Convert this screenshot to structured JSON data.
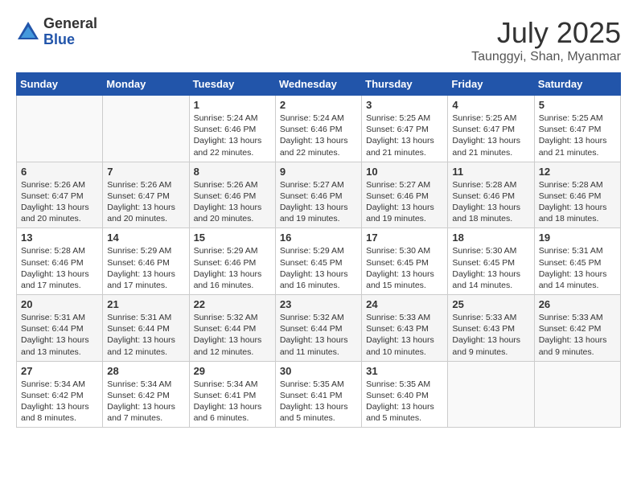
{
  "header": {
    "logo_general": "General",
    "logo_blue": "Blue",
    "month_year": "July 2025",
    "location": "Taunggyi, Shan, Myanmar"
  },
  "weekdays": [
    "Sunday",
    "Monday",
    "Tuesday",
    "Wednesday",
    "Thursday",
    "Friday",
    "Saturday"
  ],
  "weeks": [
    [
      {
        "day": "",
        "info": ""
      },
      {
        "day": "",
        "info": ""
      },
      {
        "day": "1",
        "info": "Sunrise: 5:24 AM\nSunset: 6:46 PM\nDaylight: 13 hours and 22 minutes."
      },
      {
        "day": "2",
        "info": "Sunrise: 5:24 AM\nSunset: 6:46 PM\nDaylight: 13 hours and 22 minutes."
      },
      {
        "day": "3",
        "info": "Sunrise: 5:25 AM\nSunset: 6:47 PM\nDaylight: 13 hours and 21 minutes."
      },
      {
        "day": "4",
        "info": "Sunrise: 5:25 AM\nSunset: 6:47 PM\nDaylight: 13 hours and 21 minutes."
      },
      {
        "day": "5",
        "info": "Sunrise: 5:25 AM\nSunset: 6:47 PM\nDaylight: 13 hours and 21 minutes."
      }
    ],
    [
      {
        "day": "6",
        "info": "Sunrise: 5:26 AM\nSunset: 6:47 PM\nDaylight: 13 hours and 20 minutes."
      },
      {
        "day": "7",
        "info": "Sunrise: 5:26 AM\nSunset: 6:47 PM\nDaylight: 13 hours and 20 minutes."
      },
      {
        "day": "8",
        "info": "Sunrise: 5:26 AM\nSunset: 6:46 PM\nDaylight: 13 hours and 20 minutes."
      },
      {
        "day": "9",
        "info": "Sunrise: 5:27 AM\nSunset: 6:46 PM\nDaylight: 13 hours and 19 minutes."
      },
      {
        "day": "10",
        "info": "Sunrise: 5:27 AM\nSunset: 6:46 PM\nDaylight: 13 hours and 19 minutes."
      },
      {
        "day": "11",
        "info": "Sunrise: 5:28 AM\nSunset: 6:46 PM\nDaylight: 13 hours and 18 minutes."
      },
      {
        "day": "12",
        "info": "Sunrise: 5:28 AM\nSunset: 6:46 PM\nDaylight: 13 hours and 18 minutes."
      }
    ],
    [
      {
        "day": "13",
        "info": "Sunrise: 5:28 AM\nSunset: 6:46 PM\nDaylight: 13 hours and 17 minutes."
      },
      {
        "day": "14",
        "info": "Sunrise: 5:29 AM\nSunset: 6:46 PM\nDaylight: 13 hours and 17 minutes."
      },
      {
        "day": "15",
        "info": "Sunrise: 5:29 AM\nSunset: 6:46 PM\nDaylight: 13 hours and 16 minutes."
      },
      {
        "day": "16",
        "info": "Sunrise: 5:29 AM\nSunset: 6:45 PM\nDaylight: 13 hours and 16 minutes."
      },
      {
        "day": "17",
        "info": "Sunrise: 5:30 AM\nSunset: 6:45 PM\nDaylight: 13 hours and 15 minutes."
      },
      {
        "day": "18",
        "info": "Sunrise: 5:30 AM\nSunset: 6:45 PM\nDaylight: 13 hours and 14 minutes."
      },
      {
        "day": "19",
        "info": "Sunrise: 5:31 AM\nSunset: 6:45 PM\nDaylight: 13 hours and 14 minutes."
      }
    ],
    [
      {
        "day": "20",
        "info": "Sunrise: 5:31 AM\nSunset: 6:44 PM\nDaylight: 13 hours and 13 minutes."
      },
      {
        "day": "21",
        "info": "Sunrise: 5:31 AM\nSunset: 6:44 PM\nDaylight: 13 hours and 12 minutes."
      },
      {
        "day": "22",
        "info": "Sunrise: 5:32 AM\nSunset: 6:44 PM\nDaylight: 13 hours and 12 minutes."
      },
      {
        "day": "23",
        "info": "Sunrise: 5:32 AM\nSunset: 6:44 PM\nDaylight: 13 hours and 11 minutes."
      },
      {
        "day": "24",
        "info": "Sunrise: 5:33 AM\nSunset: 6:43 PM\nDaylight: 13 hours and 10 minutes."
      },
      {
        "day": "25",
        "info": "Sunrise: 5:33 AM\nSunset: 6:43 PM\nDaylight: 13 hours and 9 minutes."
      },
      {
        "day": "26",
        "info": "Sunrise: 5:33 AM\nSunset: 6:42 PM\nDaylight: 13 hours and 9 minutes."
      }
    ],
    [
      {
        "day": "27",
        "info": "Sunrise: 5:34 AM\nSunset: 6:42 PM\nDaylight: 13 hours and 8 minutes."
      },
      {
        "day": "28",
        "info": "Sunrise: 5:34 AM\nSunset: 6:42 PM\nDaylight: 13 hours and 7 minutes."
      },
      {
        "day": "29",
        "info": "Sunrise: 5:34 AM\nSunset: 6:41 PM\nDaylight: 13 hours and 6 minutes."
      },
      {
        "day": "30",
        "info": "Sunrise: 5:35 AM\nSunset: 6:41 PM\nDaylight: 13 hours and 5 minutes."
      },
      {
        "day": "31",
        "info": "Sunrise: 5:35 AM\nSunset: 6:40 PM\nDaylight: 13 hours and 5 minutes."
      },
      {
        "day": "",
        "info": ""
      },
      {
        "day": "",
        "info": ""
      }
    ]
  ]
}
